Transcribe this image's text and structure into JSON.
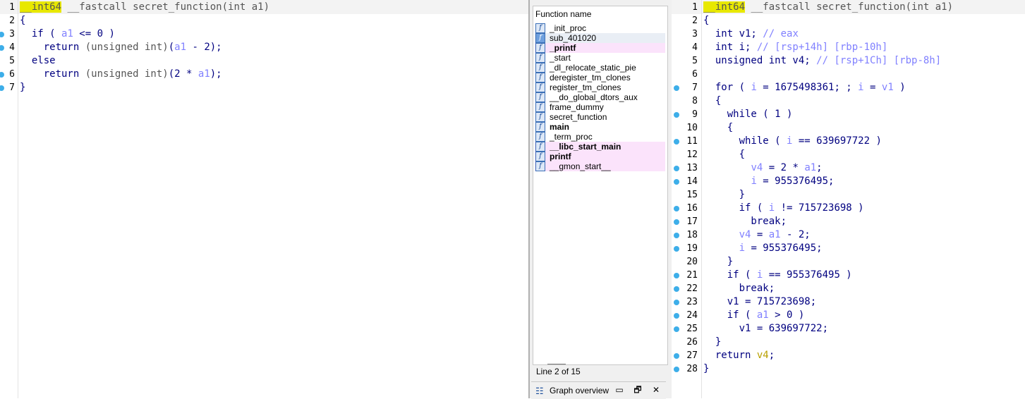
{
  "left_code": {
    "lines": [
      {
        "n": "1",
        "bp": false,
        "parts": [
          {
            "t": "__int64",
            "c": "hl-type"
          },
          {
            "t": " __fastcall secret_function(int a1)",
            "c": "gray"
          }
        ]
      },
      {
        "n": "2",
        "bp": false,
        "parts": [
          {
            "t": "{",
            "c": "kw"
          }
        ]
      },
      {
        "n": "3",
        "bp": true,
        "parts": [
          {
            "t": "  if ( ",
            "c": "kw"
          },
          {
            "t": "a1",
            "c": "var"
          },
          {
            "t": " <= 0 )",
            "c": "kw"
          }
        ]
      },
      {
        "n": "4",
        "bp": true,
        "parts": [
          {
            "t": "    return ",
            "c": "kw"
          },
          {
            "t": "(unsigned int)",
            "c": "gray"
          },
          {
            "t": "(",
            "c": "kw"
          },
          {
            "t": "a1",
            "c": "var"
          },
          {
            "t": " - 2);",
            "c": "kw"
          }
        ]
      },
      {
        "n": "5",
        "bp": false,
        "parts": [
          {
            "t": "  else",
            "c": "kw"
          }
        ]
      },
      {
        "n": "6",
        "bp": true,
        "parts": [
          {
            "t": "    return ",
            "c": "kw"
          },
          {
            "t": "(unsigned int)",
            "c": "gray"
          },
          {
            "t": "(2 * ",
            "c": "kw"
          },
          {
            "t": "a1",
            "c": "var"
          },
          {
            "t": ");",
            "c": "kw"
          }
        ]
      },
      {
        "n": "7",
        "bp": true,
        "parts": [
          {
            "t": "}",
            "c": "kw"
          }
        ]
      }
    ]
  },
  "right_code": {
    "lines": [
      {
        "n": "1",
        "bp": false,
        "parts": [
          {
            "t": "__int64",
            "c": "hl-type"
          },
          {
            "t": " __fastcall secret_function(int a1)",
            "c": "gray"
          }
        ]
      },
      {
        "n": "2",
        "bp": false,
        "parts": [
          {
            "t": "{",
            "c": "kw"
          }
        ]
      },
      {
        "n": "3",
        "bp": false,
        "parts": [
          {
            "t": "  int v1; ",
            "c": "kw"
          },
          {
            "t": "// eax",
            "c": "comment"
          }
        ]
      },
      {
        "n": "4",
        "bp": false,
        "parts": [
          {
            "t": "  int i; ",
            "c": "kw"
          },
          {
            "t": "// [rsp+14h] [rbp-10h]",
            "c": "comment"
          }
        ]
      },
      {
        "n": "5",
        "bp": false,
        "parts": [
          {
            "t": "  unsigned int v4; ",
            "c": "kw"
          },
          {
            "t": "// [rsp+1Ch] [rbp-8h]",
            "c": "comment"
          }
        ]
      },
      {
        "n": "6",
        "bp": false,
        "parts": [
          {
            "t": "",
            "c": "kw"
          }
        ]
      },
      {
        "n": "7",
        "bp": true,
        "parts": [
          {
            "t": "  for ( ",
            "c": "kw"
          },
          {
            "t": "i",
            "c": "var"
          },
          {
            "t": " = 1675498361; ; ",
            "c": "kw"
          },
          {
            "t": "i",
            "c": "var"
          },
          {
            "t": " = ",
            "c": "kw"
          },
          {
            "t": "v1",
            "c": "var"
          },
          {
            "t": " )",
            "c": "kw"
          }
        ]
      },
      {
        "n": "8",
        "bp": false,
        "parts": [
          {
            "t": "  {",
            "c": "kw"
          }
        ]
      },
      {
        "n": "9",
        "bp": true,
        "parts": [
          {
            "t": "    while ( 1 )",
            "c": "kw"
          }
        ]
      },
      {
        "n": "10",
        "bp": false,
        "parts": [
          {
            "t": "    {",
            "c": "kw"
          }
        ]
      },
      {
        "n": "11",
        "bp": true,
        "parts": [
          {
            "t": "      while ( ",
            "c": "kw"
          },
          {
            "t": "i",
            "c": "var"
          },
          {
            "t": " == 639697722 )",
            "c": "kw"
          }
        ]
      },
      {
        "n": "12",
        "bp": false,
        "parts": [
          {
            "t": "      {",
            "c": "kw"
          }
        ]
      },
      {
        "n": "13",
        "bp": true,
        "parts": [
          {
            "t": "        ",
            "c": "kw"
          },
          {
            "t": "v4",
            "c": "var"
          },
          {
            "t": " = 2 * ",
            "c": "kw"
          },
          {
            "t": "a1",
            "c": "var"
          },
          {
            "t": ";",
            "c": "kw"
          }
        ]
      },
      {
        "n": "14",
        "bp": true,
        "parts": [
          {
            "t": "        ",
            "c": "kw"
          },
          {
            "t": "i",
            "c": "var"
          },
          {
            "t": " = 955376495;",
            "c": "kw"
          }
        ]
      },
      {
        "n": "15",
        "bp": false,
        "parts": [
          {
            "t": "      }",
            "c": "kw"
          }
        ]
      },
      {
        "n": "16",
        "bp": true,
        "parts": [
          {
            "t": "      if ( ",
            "c": "kw"
          },
          {
            "t": "i",
            "c": "var"
          },
          {
            "t": " != 715723698 )",
            "c": "kw"
          }
        ]
      },
      {
        "n": "17",
        "bp": true,
        "parts": [
          {
            "t": "        break;",
            "c": "kw"
          }
        ]
      },
      {
        "n": "18",
        "bp": true,
        "parts": [
          {
            "t": "      ",
            "c": "kw"
          },
          {
            "t": "v4",
            "c": "var"
          },
          {
            "t": " = ",
            "c": "kw"
          },
          {
            "t": "a1",
            "c": "var"
          },
          {
            "t": " - 2;",
            "c": "kw"
          }
        ]
      },
      {
        "n": "19",
        "bp": true,
        "parts": [
          {
            "t": "      ",
            "c": "kw"
          },
          {
            "t": "i",
            "c": "var"
          },
          {
            "t": " = 955376495;",
            "c": "kw"
          }
        ]
      },
      {
        "n": "20",
        "bp": false,
        "parts": [
          {
            "t": "    }",
            "c": "kw"
          }
        ]
      },
      {
        "n": "21",
        "bp": true,
        "parts": [
          {
            "t": "    if ( ",
            "c": "kw"
          },
          {
            "t": "i",
            "c": "var"
          },
          {
            "t": " == 955376495 )",
            "c": "kw"
          }
        ]
      },
      {
        "n": "22",
        "bp": true,
        "parts": [
          {
            "t": "      break;",
            "c": "kw"
          }
        ]
      },
      {
        "n": "23",
        "bp": true,
        "parts": [
          {
            "t": "    v1 = 715723698;",
            "c": "kw"
          }
        ]
      },
      {
        "n": "24",
        "bp": true,
        "parts": [
          {
            "t": "    if ( ",
            "c": "kw"
          },
          {
            "t": "a1",
            "c": "var"
          },
          {
            "t": " > 0 )",
            "c": "kw"
          }
        ]
      },
      {
        "n": "25",
        "bp": true,
        "parts": [
          {
            "t": "      v1 = 639697722;",
            "c": "kw"
          }
        ]
      },
      {
        "n": "26",
        "bp": false,
        "parts": [
          {
            "t": "  }",
            "c": "kw"
          }
        ]
      },
      {
        "n": "27",
        "bp": true,
        "parts": [
          {
            "t": "  return ",
            "c": "kw"
          },
          {
            "t": "v4",
            "c": "olive"
          },
          {
            "t": ";",
            "c": "kw"
          }
        ]
      },
      {
        "n": "28",
        "bp": true,
        "parts": [
          {
            "t": "}",
            "c": "kw"
          }
        ]
      }
    ]
  },
  "functions": {
    "header": "Function name",
    "items": [
      {
        "name": "_init_proc",
        "style": ""
      },
      {
        "name": "sub_401020",
        "style": "sel"
      },
      {
        "name": "_printf",
        "style": "pink bold"
      },
      {
        "name": "_start",
        "style": ""
      },
      {
        "name": "_dl_relocate_static_pie",
        "style": ""
      },
      {
        "name": "deregister_tm_clones",
        "style": ""
      },
      {
        "name": "register_tm_clones",
        "style": ""
      },
      {
        "name": "__do_global_dtors_aux",
        "style": ""
      },
      {
        "name": "frame_dummy",
        "style": ""
      },
      {
        "name": "secret_function",
        "style": ""
      },
      {
        "name": "main",
        "style": "bold"
      },
      {
        "name": "_term_proc",
        "style": ""
      },
      {
        "name": "__libc_start_main",
        "style": "pink bold"
      },
      {
        "name": "printf",
        "style": "pink bold"
      },
      {
        "name": "__gmon_start__",
        "style": "pink"
      }
    ],
    "status": "Line 2 of 15",
    "graph_label": "Graph overview",
    "graph_icon": "tree-icon",
    "btn_minimize": "▭",
    "btn_restore": "🗗",
    "btn_close": "✕",
    "icon_glyph": "f"
  }
}
